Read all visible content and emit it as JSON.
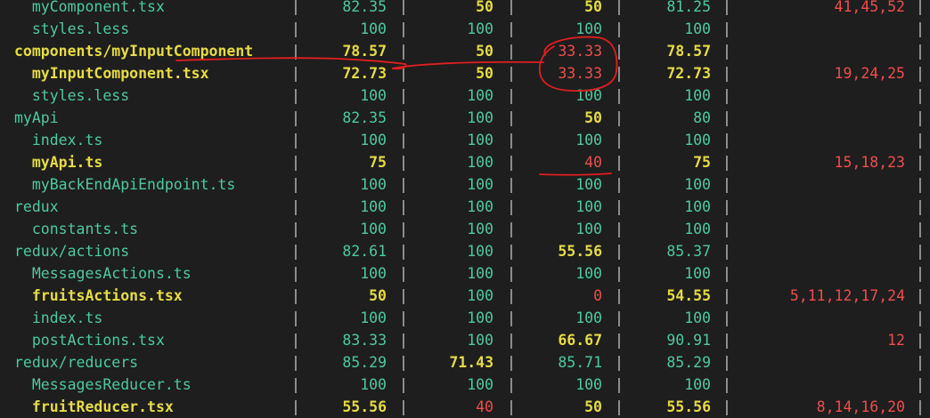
{
  "colors": {
    "high": "#4ec9a0",
    "medium": "#e6db44",
    "low": "#f14c4c",
    "separator": "#d4d4d4",
    "background": "#1e1e1e",
    "annotation": "#e01f1f"
  },
  "rows": [
    {
      "file": "  myComponent.tsx",
      "stmts": "82.35",
      "branch": "50",
      "funcs": "50",
      "lines": "81.25",
      "uncovered": "41,45,52",
      "c": [
        "green",
        "green",
        "yellow",
        "yellow",
        "green",
        "red"
      ]
    },
    {
      "file": "  styles.less",
      "stmts": "100",
      "branch": "100",
      "funcs": "100",
      "lines": "100",
      "uncovered": "",
      "c": [
        "green",
        "green",
        "green",
        "green",
        "green",
        "red"
      ]
    },
    {
      "file": "components/myInputComponent",
      "stmts": "78.57",
      "branch": "50",
      "funcs": "33.33",
      "lines": "78.57",
      "uncovered": "",
      "c": [
        "yellow",
        "yellow",
        "yellow",
        "red",
        "yellow",
        "red"
      ]
    },
    {
      "file": "  myInputComponent.tsx",
      "stmts": "72.73",
      "branch": "50",
      "funcs": "33.33",
      "lines": "72.73",
      "uncovered": "19,24,25",
      "c": [
        "yellow",
        "yellow",
        "yellow",
        "red",
        "yellow",
        "red"
      ]
    },
    {
      "file": "  styles.less",
      "stmts": "100",
      "branch": "100",
      "funcs": "100",
      "lines": "100",
      "uncovered": "",
      "c": [
        "green",
        "green",
        "green",
        "green",
        "green",
        "red"
      ]
    },
    {
      "file": "myApi",
      "stmts": "82.35",
      "branch": "100",
      "funcs": "50",
      "lines": "80",
      "uncovered": "",
      "c": [
        "green",
        "green",
        "green",
        "yellow",
        "green",
        "red"
      ]
    },
    {
      "file": "  index.ts",
      "stmts": "100",
      "branch": "100",
      "funcs": "100",
      "lines": "100",
      "uncovered": "",
      "c": [
        "green",
        "green",
        "green",
        "green",
        "green",
        "red"
      ]
    },
    {
      "file": "  myApi.ts",
      "stmts": "75",
      "branch": "100",
      "funcs": "40",
      "lines": "75",
      "uncovered": "15,18,23",
      "c": [
        "yellow",
        "yellow",
        "green",
        "red",
        "yellow",
        "red"
      ]
    },
    {
      "file": "  myBackEndApiEndpoint.ts",
      "stmts": "100",
      "branch": "100",
      "funcs": "100",
      "lines": "100",
      "uncovered": "",
      "c": [
        "green",
        "green",
        "green",
        "green",
        "green",
        "red"
      ]
    },
    {
      "file": "redux",
      "stmts": "100",
      "branch": "100",
      "funcs": "100",
      "lines": "100",
      "uncovered": "",
      "c": [
        "green",
        "green",
        "green",
        "green",
        "green",
        "red"
      ]
    },
    {
      "file": "  constants.ts",
      "stmts": "100",
      "branch": "100",
      "funcs": "100",
      "lines": "100",
      "uncovered": "",
      "c": [
        "green",
        "green",
        "green",
        "green",
        "green",
        "red"
      ]
    },
    {
      "file": "redux/actions",
      "stmts": "82.61",
      "branch": "100",
      "funcs": "55.56",
      "lines": "85.37",
      "uncovered": "",
      "c": [
        "green",
        "green",
        "green",
        "yellow",
        "green",
        "red"
      ]
    },
    {
      "file": "  MessagesActions.ts",
      "stmts": "100",
      "branch": "100",
      "funcs": "100",
      "lines": "100",
      "uncovered": "",
      "c": [
        "green",
        "green",
        "green",
        "green",
        "green",
        "red"
      ]
    },
    {
      "file": "  fruitsActions.tsx",
      "stmts": "50",
      "branch": "100",
      "funcs": "0",
      "lines": "54.55",
      "uncovered": "5,11,12,17,24",
      "c": [
        "yellow",
        "yellow",
        "green",
        "red",
        "yellow",
        "red"
      ]
    },
    {
      "file": "  index.ts",
      "stmts": "100",
      "branch": "100",
      "funcs": "100",
      "lines": "100",
      "uncovered": "",
      "c": [
        "green",
        "green",
        "green",
        "green",
        "green",
        "red"
      ]
    },
    {
      "file": "  postActions.tsx",
      "stmts": "83.33",
      "branch": "100",
      "funcs": "66.67",
      "lines": "90.91",
      "uncovered": "12",
      "c": [
        "green",
        "green",
        "green",
        "yellow",
        "green",
        "red"
      ]
    },
    {
      "file": "redux/reducers",
      "stmts": "85.29",
      "branch": "71.43",
      "funcs": "85.71",
      "lines": "85.29",
      "uncovered": "",
      "c": [
        "green",
        "green",
        "yellow",
        "green",
        "green",
        "red"
      ]
    },
    {
      "file": "  MessagesReducer.ts",
      "stmts": "100",
      "branch": "100",
      "funcs": "100",
      "lines": "100",
      "uncovered": "",
      "c": [
        "green",
        "green",
        "green",
        "green",
        "green",
        "red"
      ]
    },
    {
      "file": "  fruitReducer.tsx",
      "stmts": "55.56",
      "branch": "40",
      "funcs": "50",
      "lines": "55.56",
      "uncovered": "8,14,16,20",
      "c": [
        "yellow",
        "yellow",
        "red",
        "yellow",
        "yellow",
        "red"
      ]
    }
  ],
  "separator_char": "|"
}
